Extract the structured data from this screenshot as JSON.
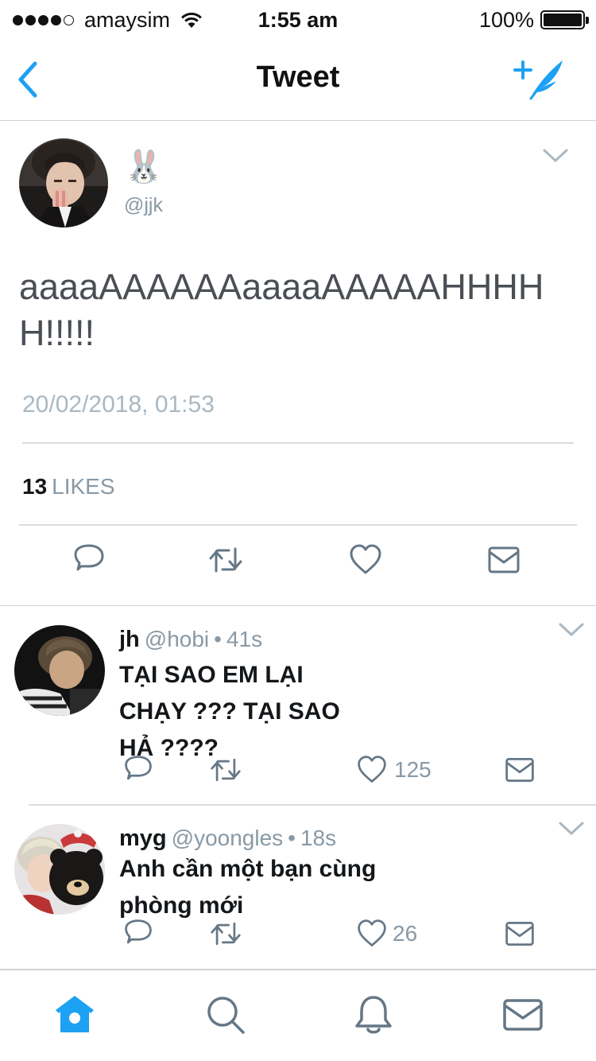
{
  "status_bar": {
    "carrier": "amaysim",
    "time": "1:55 am",
    "battery": "100%",
    "battery_level": 1.0
  },
  "nav": {
    "title": "Tweet",
    "back_icon": "chevron-left-icon",
    "compose_icon": "compose-tweet-icon"
  },
  "main_tweet": {
    "name": "🐰",
    "handle": "@jjk",
    "text": "aaaaAAAAAAaaaaAAAAAHHHHH!!!!!",
    "timestamp": "20/02/2018, 01:53",
    "likes_count": "13",
    "likes_label": "LIKES"
  },
  "replies": [
    {
      "name": "jh",
      "handle": "@hobi",
      "separator": "•",
      "ago": "41s",
      "text": "TẠI SAO EM LẠI CHẠY ??? TẠI SAO HẢ ????",
      "like_count": "125"
    },
    {
      "name": "myg",
      "handle": "@yoongles",
      "separator": "•",
      "ago": "18s",
      "text": "Anh cần một bạn cùng phòng mới",
      "like_count": "26"
    }
  ],
  "tab_bar": {
    "tabs": [
      "home-icon",
      "search-icon",
      "notifications-icon",
      "messages-icon"
    ]
  },
  "colors": {
    "accent": "#1da1f2",
    "secondary_text": "#8899a6",
    "icon_gray": "#657786"
  }
}
